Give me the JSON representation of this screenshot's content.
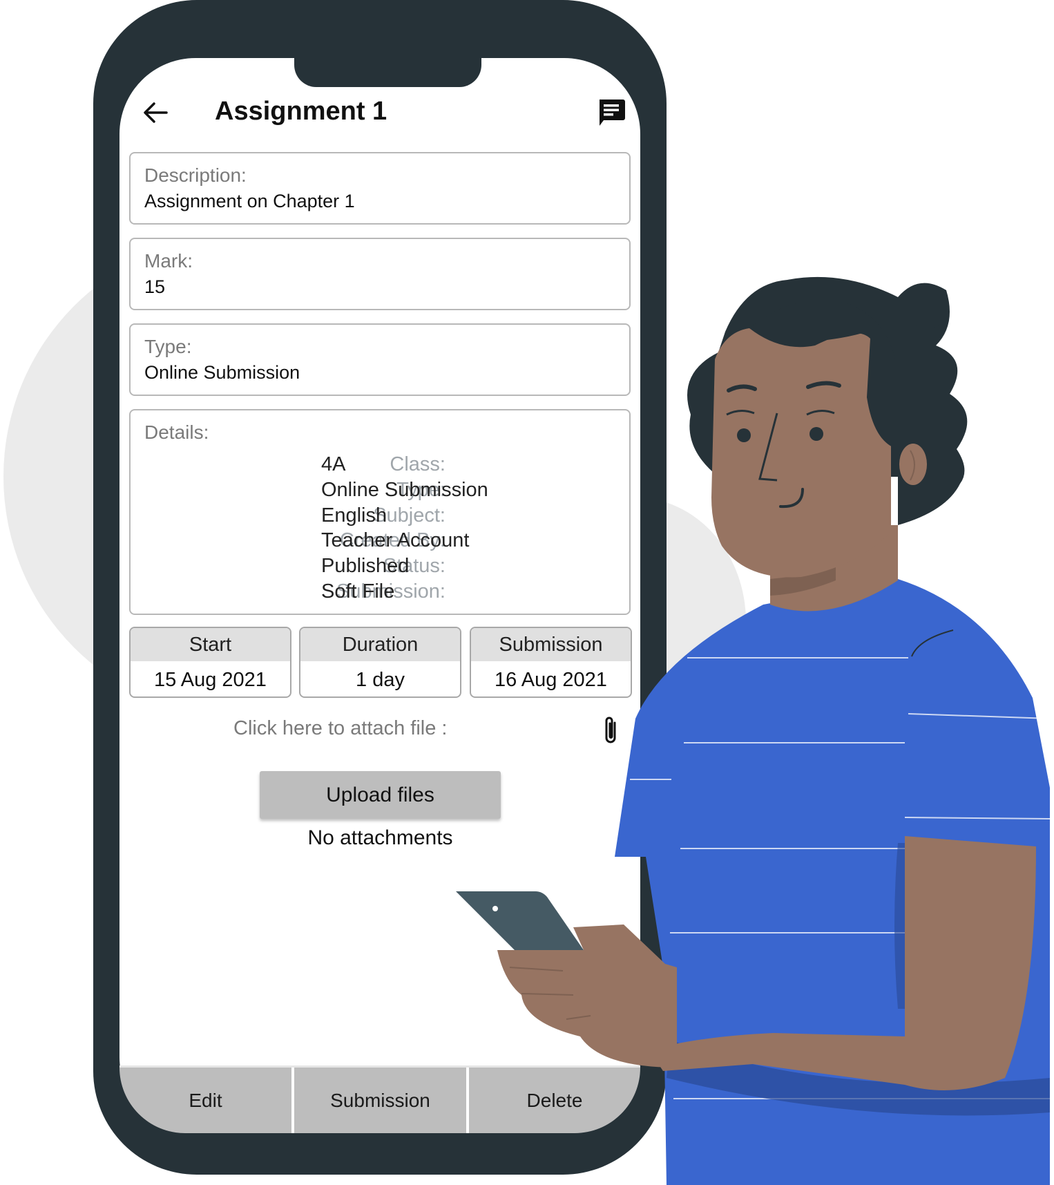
{
  "header": {
    "title": "Assignment 1",
    "back_icon": "arrow-left-icon",
    "chat_icon": "chat-message-icon"
  },
  "cards": {
    "description": {
      "label": "Description:",
      "value": "Assignment on Chapter 1"
    },
    "mark": {
      "label": "Mark:",
      "value": "15"
    },
    "type": {
      "label": "Type:",
      "value": "Online Submission"
    }
  },
  "details": {
    "label": "Details:",
    "rows": [
      {
        "key": "Class:",
        "value": "4A"
      },
      {
        "key": "Type:",
        "value": "Online Submission"
      },
      {
        "key": "Subject:",
        "value": "English"
      },
      {
        "key": "Created By:",
        "value": "Teacher Account"
      },
      {
        "key": "Status:",
        "value": "Published"
      },
      {
        "key": "Submission:",
        "value": "Soft File"
      }
    ]
  },
  "dates": [
    {
      "label": "Start",
      "value": "15 Aug 2021"
    },
    {
      "label": "Duration",
      "value": "1 day"
    },
    {
      "label": "Submission",
      "value": "16 Aug 2021"
    }
  ],
  "attach": {
    "prompt": "Click here to attach file :",
    "icon": "paperclip-icon",
    "upload_label": "Upload files",
    "status": "No attachments"
  },
  "bottom_bar": {
    "edit": "Edit",
    "submission": "Submission",
    "delete": "Delete"
  },
  "colors": {
    "phone_frame": "#263238",
    "button_gray": "#bdbdbd",
    "label_gray": "#7a7a7a",
    "shirt_blue": "#3a66cf",
    "skin": "#977462"
  }
}
